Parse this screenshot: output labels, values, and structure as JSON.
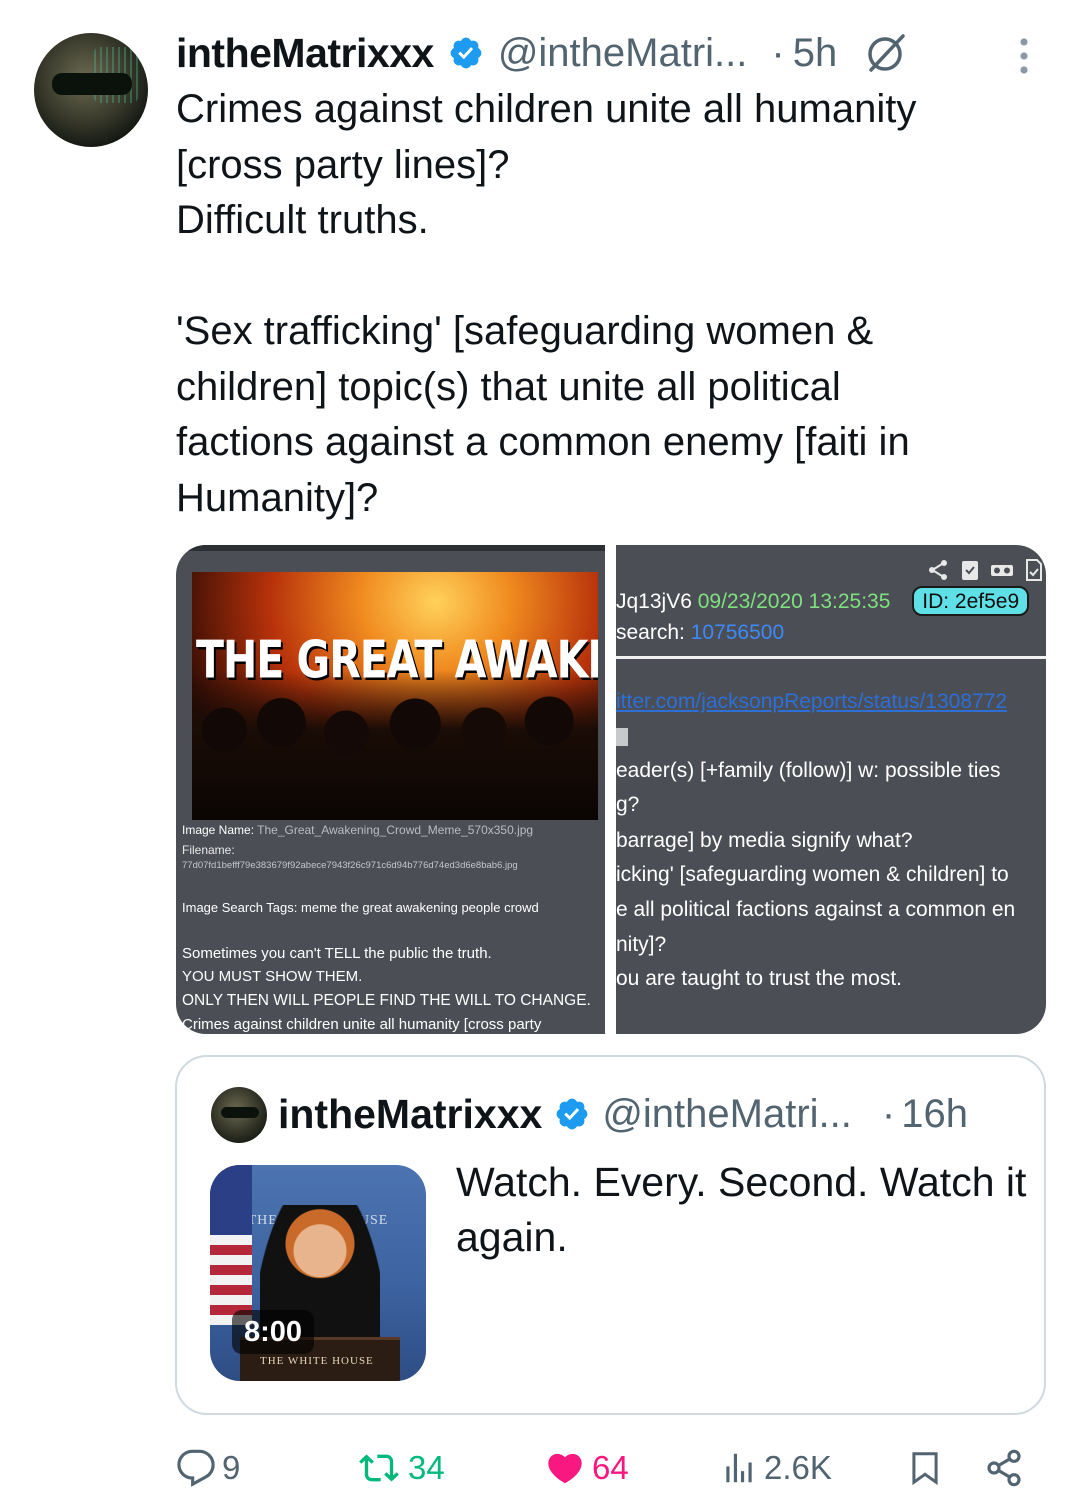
{
  "post": {
    "author_name": "intheMatrixxx",
    "author_handle": "@intheMatri...",
    "time": "5h",
    "text": "Crimes against children unite all humanity\n[cross party lines]?\nDifficult truths.\n\n'Sex trafficking' [safeguarding women &\nchildren] topic(s) that unite all political\nfactions against a common enemy [faiti in\nHumanity]?"
  },
  "media_left": {
    "image_title": "THE GREAT AWAKENING",
    "image_name_label": "Image Name:",
    "image_name_value": "The_Great_Awakening_Crowd_Meme_570x350.jpg",
    "filename_label": "Filename:",
    "filename_value": "77d07fd1befff79e383679f92abece7943f26c971c6d94b776d74ed3d6e8bab6.jpg",
    "tags_label": "Image Search Tags:",
    "tags_value": "meme the great awakening people crowd",
    "lines": [
      "Sometimes you can't TELL the public the truth.",
      "YOU MUST SHOW THEM.",
      "ONLY THEN WILL PEOPLE FIND THE WILL TO CHANGE.",
      "Crimes against children unite all humanity [cross party"
    ]
  },
  "media_right": {
    "post_id": "Jq13jV6",
    "date": "09/23/2020 13:25:35",
    "id_badge": "ID: 2ef5e9",
    "search_label": "search:",
    "search_value": "10756500",
    "link": "itter.com/jacksonpReports/status/1308772",
    "lines": [
      "eader(s) [+family (follow)] w: possible ties",
      "g?",
      "barrage] by media signify what?",
      "icking' [safeguarding women & children] to",
      "e all political factions against a common en",
      "nity]?",
      "ou are taught to trust the most."
    ]
  },
  "quoted": {
    "author_name": "intheMatrixxx",
    "author_handle": "@intheMatri...",
    "time": "16h",
    "text": "Watch. Every. Second. Watch it again.",
    "video_duration": "8:00",
    "video_podium": "THE WHITE HOUSE",
    "video_backdrop": "THE WHITE HOUSE"
  },
  "actions": {
    "replies": "9",
    "reposts": "34",
    "likes": "64",
    "views": "2.6K"
  },
  "colors": {
    "verified": "#1d9bf0",
    "repost": "#00ba7c",
    "like": "#f91880",
    "muted": "#536471"
  },
  "icons": [
    "verified-badge-icon",
    "grok-icon",
    "more-icon",
    "reply-icon",
    "repost-icon",
    "like-icon",
    "views-icon",
    "bookmark-icon",
    "share-icon"
  ]
}
